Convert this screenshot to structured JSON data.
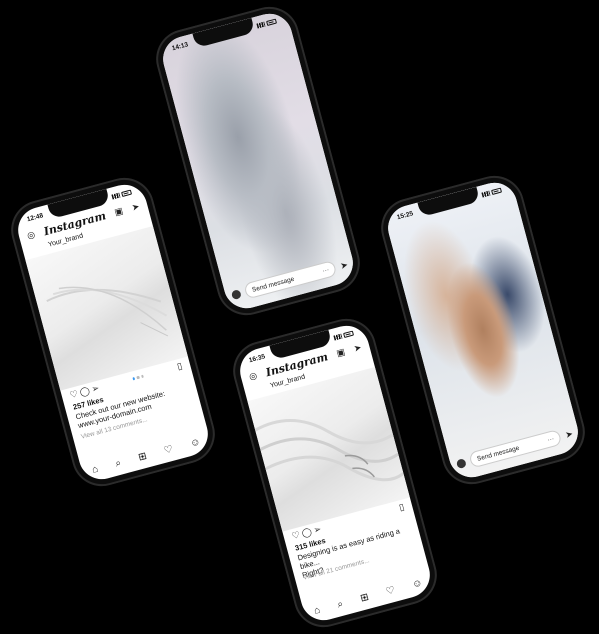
{
  "phones": {
    "left": {
      "time": "12:48",
      "app_logo": "Instagram",
      "username": "Your_brand",
      "likes": "257 likes",
      "caption_line1": "Check out our new website:",
      "caption_line2": "www.your-domain.com",
      "comments": "View all 13 comments..."
    },
    "top": {
      "time": "14:13",
      "message_placeholder": "Send message"
    },
    "right": {
      "time": "15:25",
      "message_placeholder": "Send message"
    },
    "bottom": {
      "time": "16:35",
      "app_logo": "Instagram",
      "username": "Your_brand",
      "likes": "315 likes",
      "caption_line1": "Designing is as easy as riding a bike...",
      "caption_line2": "Right?",
      "comments": "View all 21 comments..."
    }
  },
  "icons": {
    "camera": "camera-icon",
    "tv": "igtv-icon",
    "send": "send-icon",
    "heart": "heart-icon",
    "comment": "comment-icon",
    "share": "share-icon",
    "bookmark": "bookmark-icon",
    "home": "home-icon",
    "search": "search-icon",
    "add": "add-post-icon",
    "activity": "activity-icon",
    "profile": "profile-icon",
    "more": "more-icon"
  },
  "colors": {
    "background": "#000000",
    "phone_frame": "#0d0d0d",
    "like_dot_active": "#3897f0"
  }
}
